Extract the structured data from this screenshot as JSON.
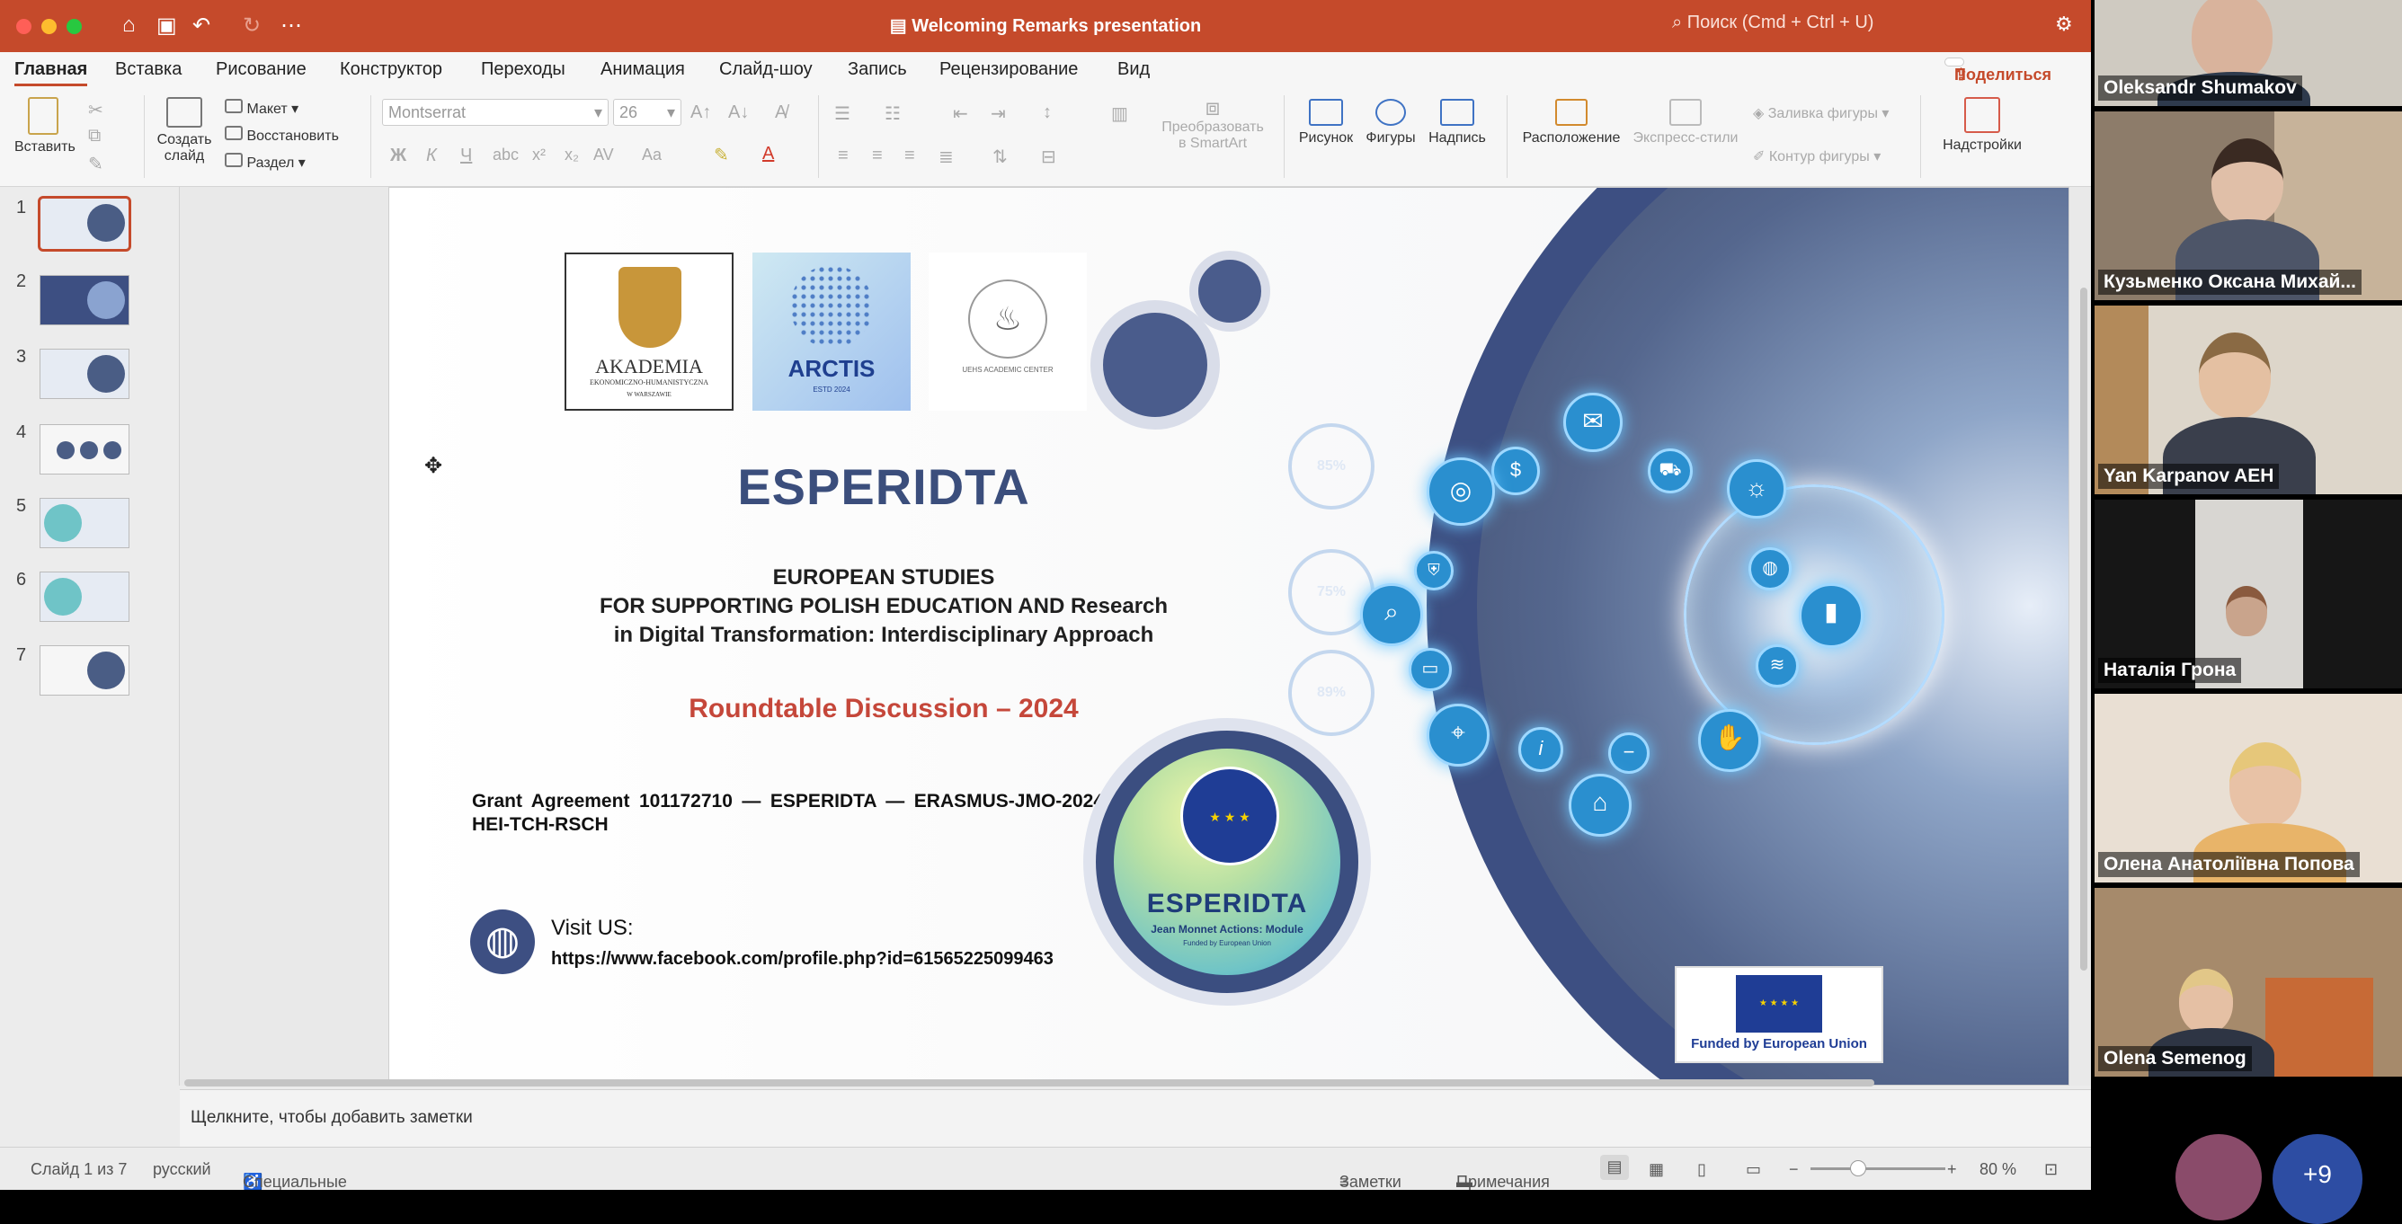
{
  "window": {
    "title": "Welcoming Remarks presentation",
    "search_placeholder": "Поиск (Cmd + Ctrl + U)"
  },
  "menu": {
    "tabs": [
      "Главная",
      "Вставка",
      "Рисование",
      "Конструктор",
      "Переходы",
      "Анимация",
      "Слайд-шоу",
      "Запись",
      "Рецензирование",
      "Вид"
    ],
    "active_tab": "Главная",
    "share": "Поделиться"
  },
  "ribbon": {
    "paste": "Вставить",
    "new_slide_1": "Создать",
    "new_slide_2": "слайд",
    "layout": "Макет",
    "reset": "Восстановить",
    "section": "Раздел",
    "font_name": "Montserrat",
    "font_size": "26",
    "convert_smartart_1": "Преобразовать",
    "convert_smartart_2": "в SmartArt",
    "picture": "Рисунок",
    "shapes": "Фигуры",
    "textbox": "Надпись",
    "arrange": "Расположение",
    "quick_styles": "Экспресс-стили",
    "shape_fill": "Заливка фигуры",
    "shape_outline": "Контур фигуры",
    "addins": "Надстройки"
  },
  "thumbnails": [
    "1",
    "2",
    "3",
    "4",
    "5",
    "6",
    "7"
  ],
  "slide": {
    "logo1_name": "AKADEMIA",
    "logo1_sub": "EKONOMICZNO-HUMANISTYCZNA",
    "logo1_city": "W WARSZAWIE",
    "logo2_name": "ARCTIS",
    "logo2_sub": "ESTD 2024",
    "logo3_name": "UEHS ACADEMIC CENTER",
    "title": "ESPERIDTA",
    "subtitle_1": "EUROPEAN STUDIES",
    "subtitle_2": "FOR SUPPORTING POLISH EDUCATION AND Research",
    "subtitle_3": "in Digital Transformation: Interdisciplinary Approach",
    "event": "Roundtable Discussion – 2024",
    "grant": "Grant Agreement 101172710 — ESPERIDTA — ERASMUS-JMO-2024-HEI-TCH-RSCH",
    "visit_label": "Visit US:",
    "visit_url": "https://www.facebook.com/profile.php?id=61565225099463",
    "badge_title": "ESPERIDTA",
    "badge_sub": "Jean Monnet Actions: Module",
    "badge_sub2": "Funded by European Union",
    "funded": "Funded by European Union",
    "pct_1": "85%",
    "pct_2": "75%",
    "pct_3": "89%"
  },
  "notes_placeholder": "Щелкните, чтобы добавить заметки",
  "status": {
    "slide_counter": "Слайд 1 из 7",
    "language": "русский",
    "accessibility": "Специальные возможности: проверьте рекомендации",
    "notes": "Заметки",
    "comments": "Примечания",
    "zoom": "80 %"
  },
  "participants": [
    {
      "name": "Oleksandr Shumakov",
      "bg": "#c9c4ba"
    },
    {
      "name": "Кузьменко Оксана Михай...",
      "bg": "#8d7c6a"
    },
    {
      "name": "Yan Karpanov AEH",
      "bg": "#d9d3c8"
    },
    {
      "name": "Наталія Грона",
      "bg": "#1a1a1a"
    },
    {
      "name": "Олена Анатоліївна Попова",
      "bg": "#e8ddd0"
    },
    {
      "name": "Olena Semenog",
      "bg": "#a6896a"
    }
  ],
  "more_participants": "+9"
}
